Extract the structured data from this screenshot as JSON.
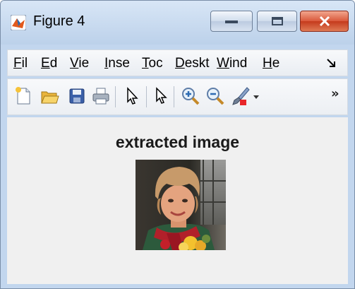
{
  "window": {
    "title": "Figure 4"
  },
  "menu": {
    "items": [
      {
        "accel": "F",
        "rest": "il"
      },
      {
        "accel": "E",
        "rest": "d"
      },
      {
        "accel": "V",
        "rest": "ie"
      },
      {
        "accel": "I",
        "rest": "nse"
      },
      {
        "accel": "T",
        "rest": "oc"
      },
      {
        "accel": "D",
        "rest": "eskt"
      },
      {
        "accel": "W",
        "rest": "ind"
      },
      {
        "accel": "H",
        "rest": "e"
      }
    ]
  },
  "toolbar": {
    "icons": [
      "new-file-icon",
      "open-folder-icon",
      "save-icon",
      "print-icon",
      "pointer-icon",
      "edit-plot-icon",
      "zoom-in-icon",
      "zoom-out-icon",
      "brush-icon",
      "dropdown-arrow-icon",
      "overflow-icon"
    ],
    "overflow_label": "»"
  },
  "figure": {
    "axes_title": "extracted image",
    "colors": {
      "skin": "#e4a37f",
      "hair": "#c79a6a",
      "scarf": "#b1202a",
      "background_dark": "#2c2b27",
      "flowers": "#f3c12e"
    }
  }
}
